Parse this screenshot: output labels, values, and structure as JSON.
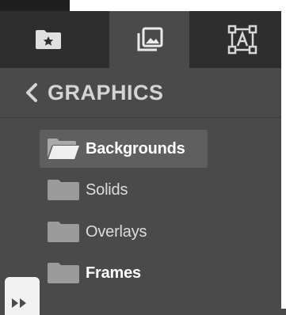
{
  "tabs": [
    {
      "icon": "folder-star-icon",
      "active": false
    },
    {
      "icon": "image-stack-icon",
      "active": true
    },
    {
      "icon": "text-box-icon",
      "active": false
    }
  ],
  "header": {
    "title": "GRAPHICS",
    "back_icon": "chevron-left-icon"
  },
  "folders": [
    {
      "label": "Backgrounds",
      "selected": true,
      "icon": "open-folder-icon"
    },
    {
      "label": "Solids",
      "selected": false,
      "icon": "folder-icon"
    },
    {
      "label": "Overlays",
      "selected": false,
      "icon": "folder-icon"
    },
    {
      "label": "Frames",
      "selected": false,
      "icon": "folder-icon"
    }
  ],
  "expander": {
    "icon": "double-chevron-right-icon"
  },
  "colors": {
    "panel": "#4a4a4a",
    "tabbar": "#2e2e2e",
    "selected_row": "#5f5f5f",
    "text": "#dcdcdc"
  }
}
